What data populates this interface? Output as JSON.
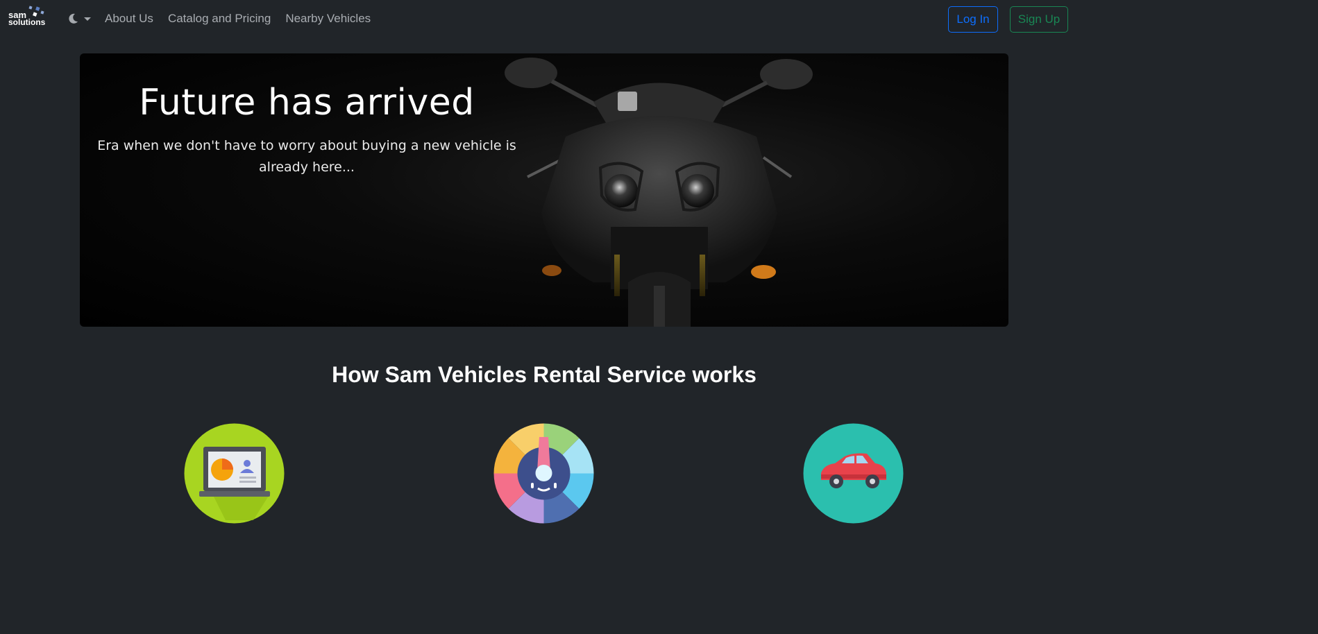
{
  "brand": {
    "name": "sam solutions",
    "logo_lines": [
      "sam",
      "solutions"
    ]
  },
  "nav": {
    "theme_icon": "moon-icon",
    "links": [
      "About Us",
      "Catalog and Pricing",
      "Nearby Vehicles"
    ],
    "login_label": "Log In",
    "signup_label": "Sign Up"
  },
  "hero": {
    "title": "Future has arrived",
    "subtitle": "Era when we don't have to worry about buying a new vehicle is already here..."
  },
  "how_it_works": {
    "title": "How Sam Vehicles Rental Service works",
    "steps": [
      {
        "icon": "laptop-dashboard-icon"
      },
      {
        "icon": "speedometer-icon"
      },
      {
        "icon": "car-icon"
      }
    ]
  },
  "colors": {
    "background": "#212529",
    "primary": "#0d6efd",
    "success": "#198754",
    "step1_bg": "#a8d521",
    "step3_bg": "#2bbfae"
  }
}
